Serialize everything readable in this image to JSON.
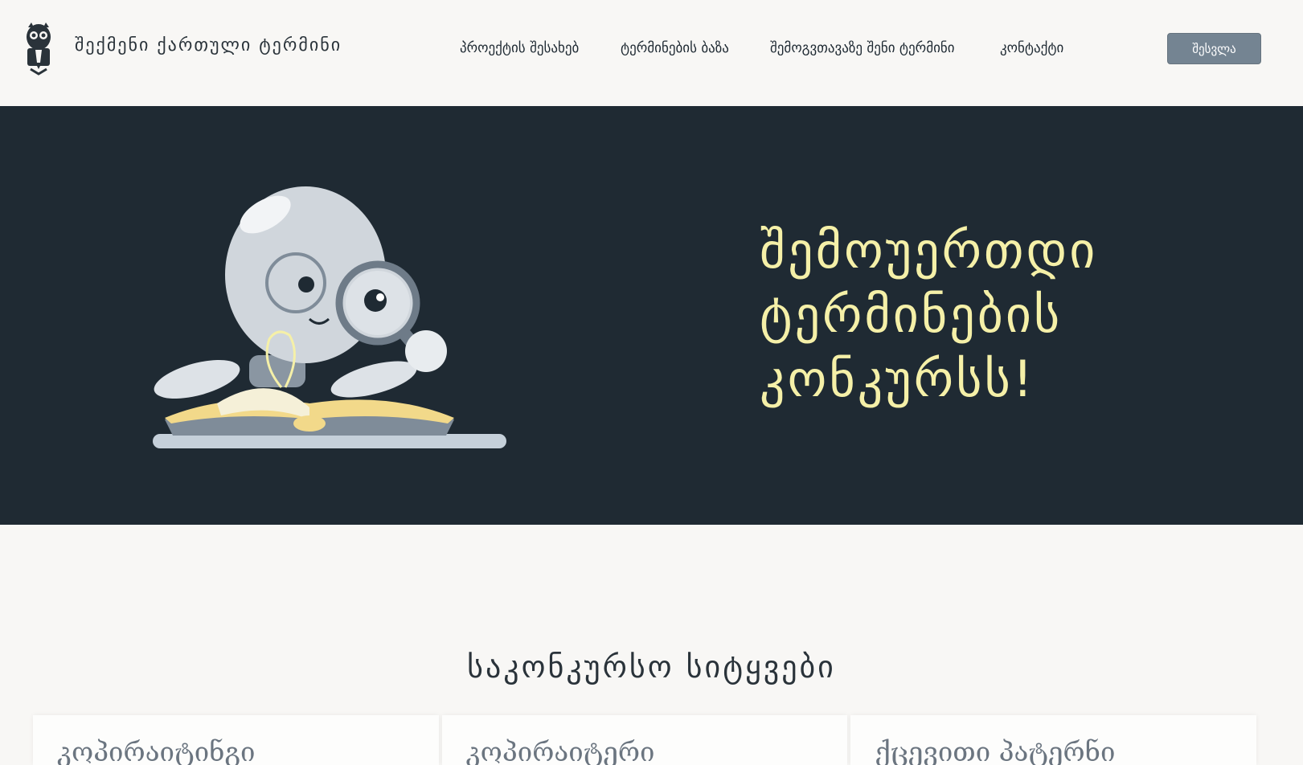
{
  "header": {
    "brand": "შექმენი ქართული ტერმინი",
    "nav": [
      "პროექტის შესახებ",
      "ტერმინების ბაზა",
      "შემოგვთავაზე შენი ტერმინი",
      "კონტაქტი"
    ],
    "login_label": "შესვლა",
    "logo_icon": "owl-logo-icon"
  },
  "hero": {
    "title_lines": [
      "შემოუერთდი",
      "ტერმინების",
      "კონკურსს!"
    ],
    "illustration": "lightbulb-reading-book-illustration",
    "colors": {
      "background": "#1f2a33",
      "title": "#f5f0a8"
    }
  },
  "section": {
    "title": "საკონკურსო სიტყვები",
    "cards": [
      {
        "title": "კოპირაიტინგი"
      },
      {
        "title": "კოპირაიტერი"
      },
      {
        "title": "ქცევითი პატერნი"
      }
    ]
  },
  "colors": {
    "page_background": "#f8f7f5",
    "button": "#748492"
  }
}
